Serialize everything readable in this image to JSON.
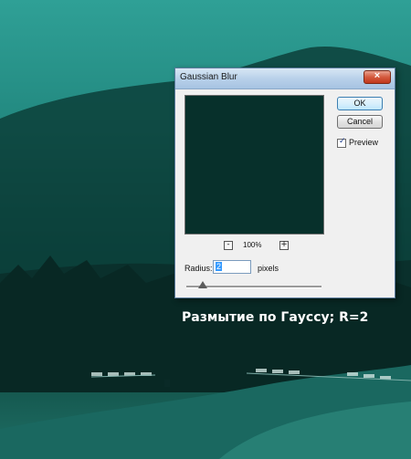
{
  "dialog": {
    "title": "Gaussian Blur",
    "close_symbol": "×",
    "ok_label": "OK",
    "cancel_label": "Cancel",
    "preview_label": "Preview",
    "preview_checked": true,
    "zoom_minus": "-",
    "zoom_plus": "+",
    "zoom_level": "100%",
    "radius_label": "Radius:",
    "radius_value": "2",
    "radius_unit": "pixels"
  },
  "caption": "Размытие по Гауссу; R=2",
  "colors": {
    "preview_fill": "#07302b",
    "scene_teal": "#22887f"
  }
}
